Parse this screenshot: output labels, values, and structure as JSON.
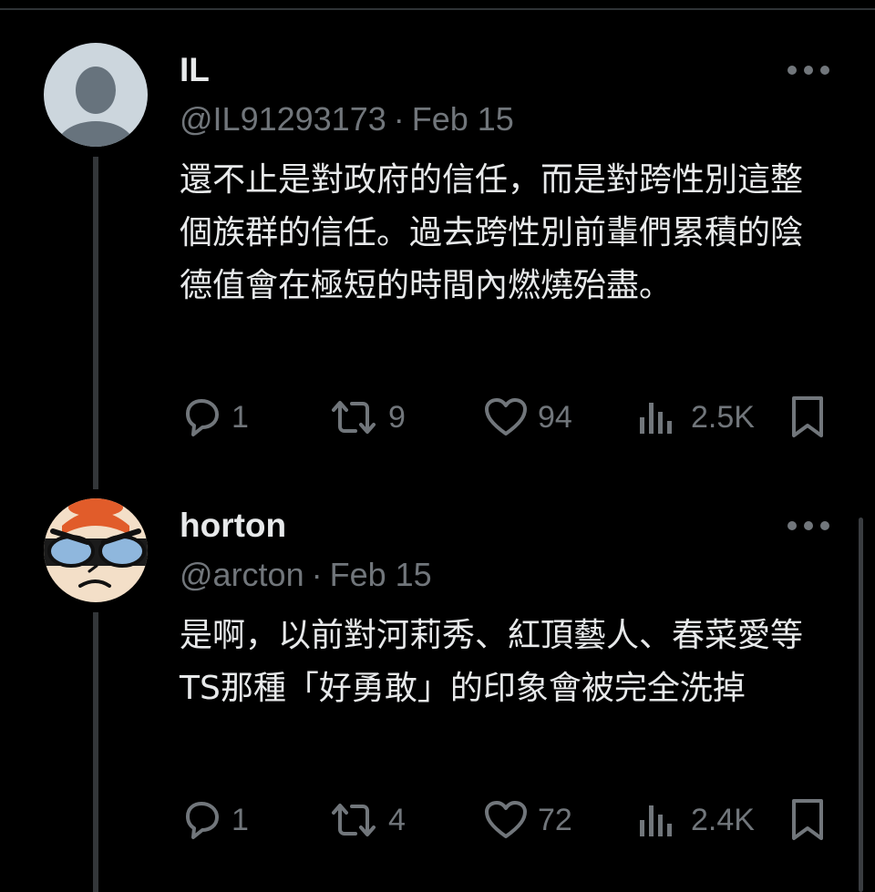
{
  "tweets": [
    {
      "name": "IL",
      "handle": "@IL91293173",
      "separator": "·",
      "date": "Feb 15",
      "text": "還不止是對政府的信任，而是對跨性別這整個族群的信任。過去跨性別前輩們累積的陰德值會在極短的時間內燃燒殆盡。",
      "replies": "1",
      "retweets": "9",
      "likes": "94",
      "views": "2.5K",
      "avatar": "default-avatar-icon"
    },
    {
      "name": "horton",
      "handle": "@arcton",
      "separator": "·",
      "date": "Feb 15",
      "text": "是啊，以前對河莉秀、紅頂藝人、春菜愛等TS那種「好勇敢」的印象會被完全洗掉",
      "replies": "1",
      "retweets": "4",
      "likes": "72",
      "views": "2.4K",
      "avatar": "cartoon-avatar-icon"
    }
  ],
  "colors": {
    "background": "#000000",
    "text_primary": "#e7e9ea",
    "text_secondary": "#71767b",
    "thread_line": "#333639"
  }
}
